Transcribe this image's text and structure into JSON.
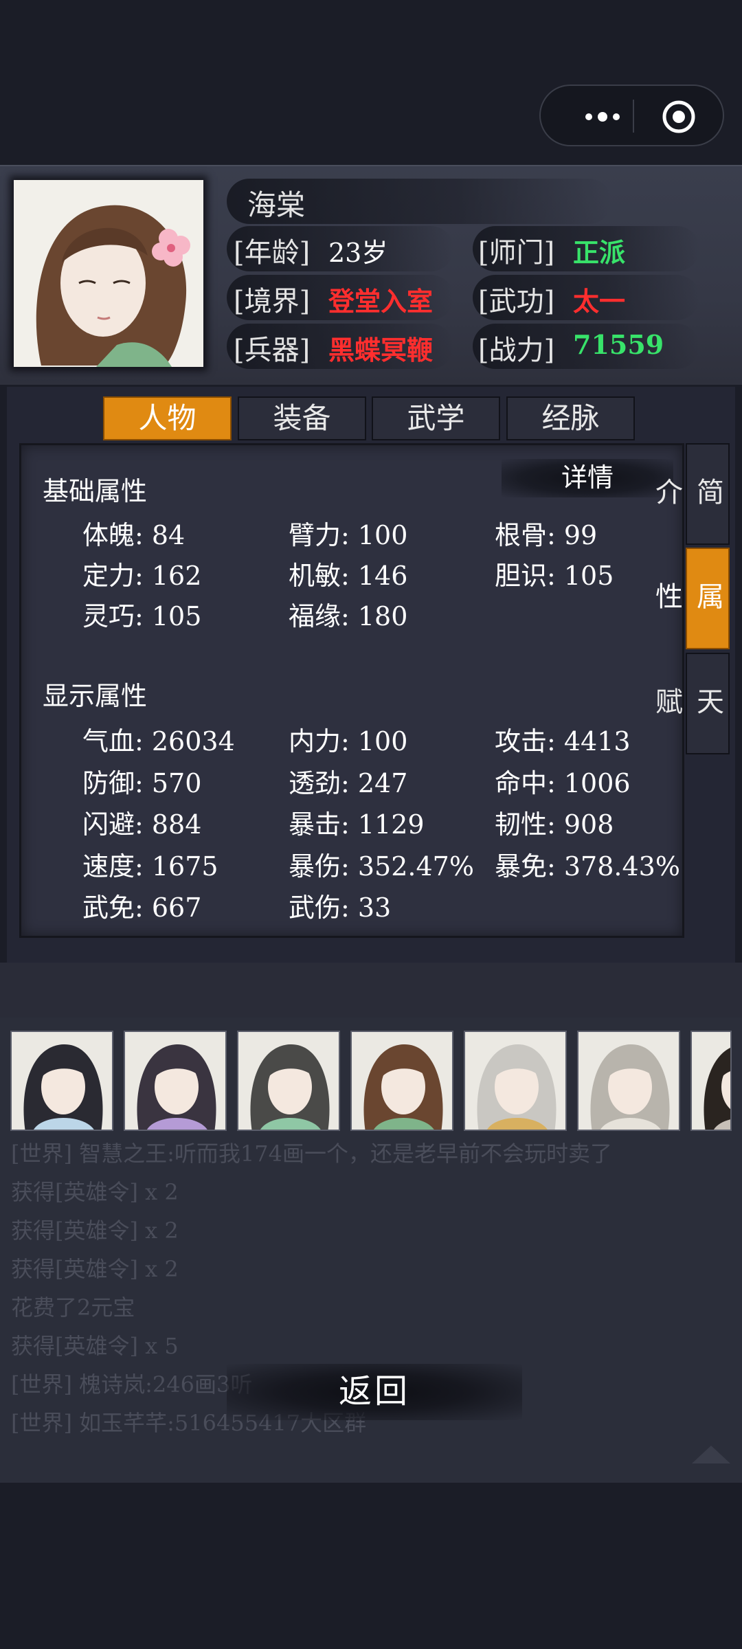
{
  "header": {
    "name": "海棠",
    "rows": [
      [
        {
          "label": "[年龄]",
          "value": "23岁",
          "tone": "white"
        },
        {
          "label": "[师门]",
          "value": "正派",
          "tone": "green"
        }
      ],
      [
        {
          "label": "[境界]",
          "value": "登堂入室",
          "tone": "red"
        },
        {
          "label": "[武功]",
          "value": "太一",
          "tone": "red"
        }
      ],
      [
        {
          "label": "[兵器]",
          "value": "黑蝶冥鞭",
          "tone": "red"
        },
        {
          "label": "[战力]",
          "value": "71559",
          "tone": "green"
        }
      ]
    ]
  },
  "tabs": [
    "人物",
    "装备",
    "武学",
    "经脉"
  ],
  "active_tab": 0,
  "side_tabs": [
    "简介",
    "属性",
    "天赋"
  ],
  "active_side_tab": 1,
  "detail_label": "详情",
  "basic": {
    "title": "基础属性",
    "rows": [
      [
        "体魄: 84",
        "臂力: 100",
        "根骨: 99"
      ],
      [
        "定力: 162",
        "机敏: 146",
        "胆识: 105"
      ],
      [
        "灵巧: 105",
        "福缘: 180",
        ""
      ]
    ]
  },
  "display": {
    "title": "显示属性",
    "rows": [
      [
        "气血: 26034",
        "内力: 100",
        "攻击: 4413"
      ],
      [
        "防御: 570",
        "透劲: 247",
        "命中: 1006"
      ],
      [
        "闪避: 884",
        "暴击: 1129",
        "韧性: 908"
      ],
      [
        "速度: 1675",
        "暴伤: 352.47%",
        "暴免: 378.43%"
      ],
      [
        "武免: 667",
        "武伤: 33",
        ""
      ]
    ]
  },
  "chat": [
    "[世界] 智慧之王:听而我174画一个，还是老早前不会玩时卖了",
    "获得[英雄令] x 2",
    "获得[英雄令] x 2",
    "获得[英雄令] x 2",
    "花费了2元宝",
    "获得[英雄令] x 5",
    "[世界] 槐诗岚:246画3听",
    "[世界] 如玉芊芊:516455417大区群"
  ],
  "back_label": "返回",
  "colors": {
    "accent": "#e08a12",
    "red": "#ff2e2e",
    "green": "#38e36a"
  }
}
